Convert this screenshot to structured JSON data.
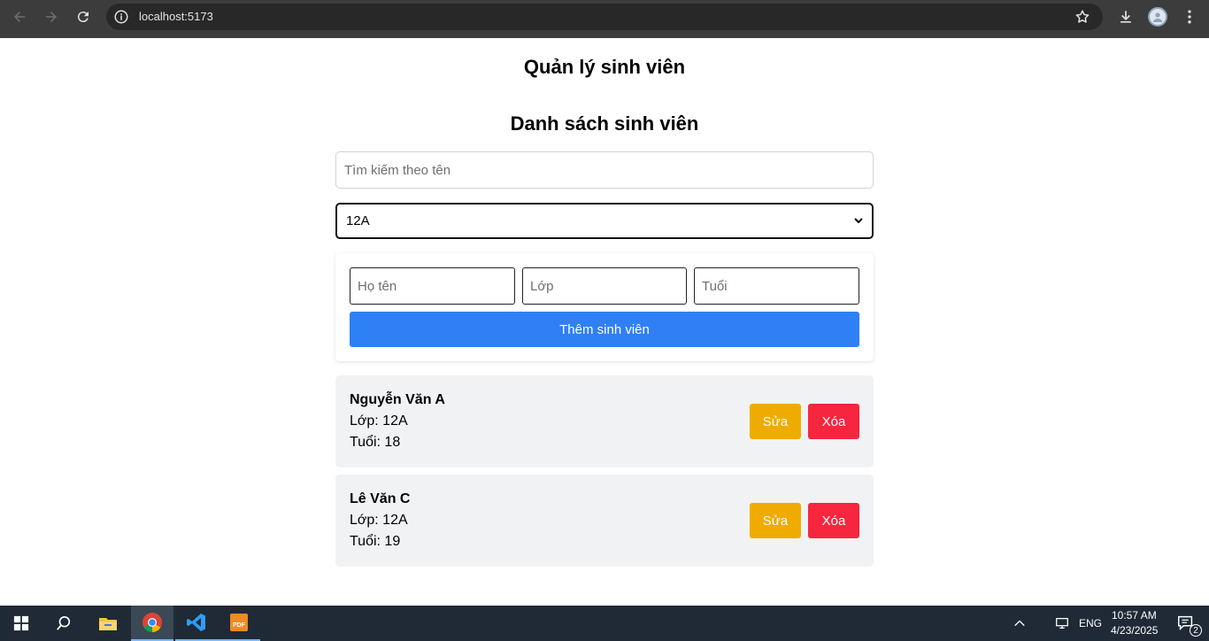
{
  "browser": {
    "url": "localhost:5173"
  },
  "page": {
    "title": "Quản lý sinh viên",
    "list_title": "Danh sách sinh viên",
    "search": {
      "placeholder": "Tìm kiếm theo tên",
      "value": ""
    },
    "class_filter": {
      "selected": "12A"
    },
    "form": {
      "name_placeholder": "Họ tên",
      "class_placeholder": "Lớp",
      "age_placeholder": "Tuổi",
      "submit_label": "Thêm sinh viên"
    },
    "students": [
      {
        "name": "Nguyễn Văn A",
        "class_line": "Lớp: 12A",
        "age_line": "Tuổi: 18",
        "edit_label": "Sửa",
        "delete_label": "Xóa"
      },
      {
        "name": "Lê Văn C",
        "class_line": "Lớp: 12A",
        "age_line": "Tuổi: 19",
        "edit_label": "Sửa",
        "delete_label": "Xóa"
      }
    ]
  },
  "taskbar": {
    "language": "ENG",
    "time": "10:57 AM",
    "date": "4/23/2025",
    "notification_count": "2"
  },
  "colors": {
    "primary": "#2f7ff5",
    "edit": "#f0ab00",
    "delete": "#f5263e",
    "card_bg": "#f1f2f4"
  }
}
